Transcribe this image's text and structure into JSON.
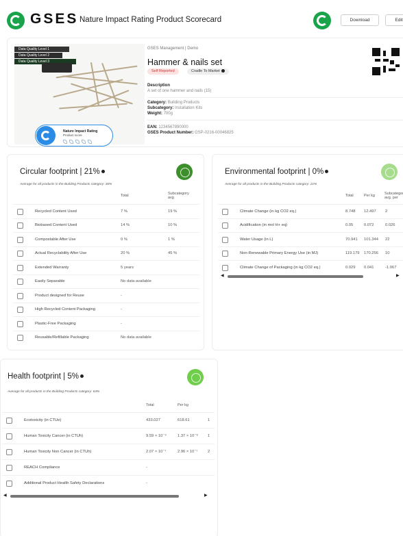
{
  "header": {
    "brand": "GSES",
    "title": "Nature Impact Rating Product Scorecard",
    "download_label": "Download",
    "edit_label": "Edit"
  },
  "product": {
    "data_quality": [
      "Data Quality Level 1",
      "Data Quality Level 2",
      "Data Quality Level 3"
    ],
    "rating_title": "Nature Impact Rating",
    "rating_sub": "Product score",
    "org": "GSES Management | Demo",
    "name": "Hammer & nails set",
    "tags": {
      "self": "Self Reported",
      "cradle": "Cradle To Market"
    },
    "description_label": "Description",
    "description": "A set of one hammer and nails (15)",
    "category_label": "Category:",
    "category": "Building Products",
    "subcategory_label": "Subcategory:",
    "subcategory": "Installation Kits",
    "weight_label": "Weight:",
    "weight": "700g",
    "ean_label": "EAN:",
    "ean": "1234567890000",
    "product_number_label": "GSES Product Number:",
    "product_number": "GSP-0216-00046825"
  },
  "circular": {
    "title": "Circular footprint | 21%",
    "avg": "Average for all products in the Building Products category: 36%",
    "badge_color": "#3d8f2b",
    "col_total": "Total",
    "col_sub": "Subcategory avg",
    "rows": [
      {
        "label": "Recycled Content Used",
        "total": "7 %",
        "sub": "19 %"
      },
      {
        "label": "Biobased Content Used",
        "total": "14 %",
        "sub": "10 %"
      },
      {
        "label": "Compostable After Use",
        "total": "0 %",
        "sub": "1 %"
      },
      {
        "label": "Actual Recyclability After Use",
        "total": "20 %",
        "sub": "45 %"
      },
      {
        "label": "Extended Warranty",
        "total": "5 years",
        "sub": ""
      },
      {
        "label": "Easily Separable",
        "total": "No data available",
        "sub": ""
      },
      {
        "label": "Product designed for Reuse",
        "total": "-",
        "sub": ""
      },
      {
        "label": "High Recycled Content Packaging",
        "total": "-",
        "sub": ""
      },
      {
        "label": "Plastic-Free Packaging",
        "total": "-",
        "sub": ""
      },
      {
        "label": "Reusable/Refillable Packaging",
        "total": "No data available",
        "sub": ""
      }
    ]
  },
  "environmental": {
    "title": "Environmental footprint | 0%",
    "avg": "Average for all products in the Building Products category: 21%",
    "badge_color": "#a6dc8b",
    "col_total": "Total",
    "col_perkg": "Per kg",
    "col_sub": "Subcategory avg. per",
    "rows": [
      {
        "label": "Climate Change (in kg CO2 eq.)",
        "total": "8.748",
        "perkg": "12.497",
        "sub": "2"
      },
      {
        "label": "Acidification (in mol H+ eq)",
        "total": "0.05",
        "perkg": "0.072",
        "sub": "0.026"
      },
      {
        "label": "Water Usage (in L)",
        "total": "70.941",
        "perkg": "101.344",
        "sub": "22"
      },
      {
        "label": "Non-Renewable Primary Energy Use (in MJ)",
        "total": "119.179",
        "perkg": "170.256",
        "sub": "10"
      },
      {
        "label": "Climate Change of Packaging (in kg CO2 eq.)",
        "total": "0.029",
        "perkg": "0.041",
        "sub": "-1.067"
      }
    ]
  },
  "health": {
    "title": "Health footprint | 5%",
    "avg": "Average for all products in the Building Products category: 64%",
    "badge_color": "#6fcf4a",
    "col_total": "Total",
    "col_perkg": "Per kg",
    "rows": [
      {
        "label": "Ecotoxicity (in CTUe)",
        "total": "433.027",
        "perkg": "618.61",
        "extra": "1"
      },
      {
        "label": "Human Toxicity Cancer (in CTUh)",
        "total": "9.59 × 10⁻⁹",
        "perkg": "1.37 × 10⁻⁸",
        "extra": "1"
      },
      {
        "label": "Human Toxicity Non Cancer (in CTUh)",
        "total": "2.07 × 10⁻⁷",
        "perkg": "2.96 × 10⁻⁷",
        "extra": "2"
      },
      {
        "label": "REACH Compliance",
        "total": "-",
        "perkg": "",
        "extra": ""
      },
      {
        "label": "Additional Product Health Safety Declarations",
        "total": "-",
        "perkg": "",
        "extra": ""
      }
    ]
  }
}
